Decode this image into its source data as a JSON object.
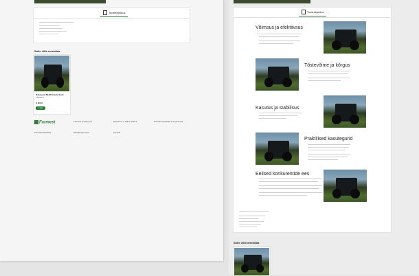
{
  "tab_label": "Tootekirjeldus",
  "left": {
    "related_title": "Sulle võib meeldida",
    "product_title": "Kobuscat 7B400 tractorfront",
    "product_sub": "Laadurid",
    "price": "3 490 €",
    "add_label": "Lisa",
    "footer_logo": "Farmest",
    "footer_cols": [
      "Farmest Trading OÜ",
      "Kaupluse 1, Tallinn 10619",
      "Privaatsuspoliitika & tingimused"
    ],
    "footer_links": [
      "Privaatsuspoliitika",
      "Müügitingimused",
      "Kontakt"
    ]
  },
  "right": {
    "sections": [
      {
        "title": "Võimsus ja efektiivsus",
        "side": "left"
      },
      {
        "title": "Tõstevõime ja kõrgus",
        "side": "right"
      },
      {
        "title": "Kasutus ja stabiilsus",
        "side": "left"
      },
      {
        "title": "Praktilised kasutegurid",
        "side": "right"
      },
      {
        "title": "Eelised konkurentide ees",
        "side": "left"
      }
    ],
    "related_title": "Sulle võib meeldida"
  },
  "colors": {
    "accent": "#2f7d3b",
    "hero": "#3d4a2e"
  },
  "icons": {
    "tab": "document-icon"
  }
}
